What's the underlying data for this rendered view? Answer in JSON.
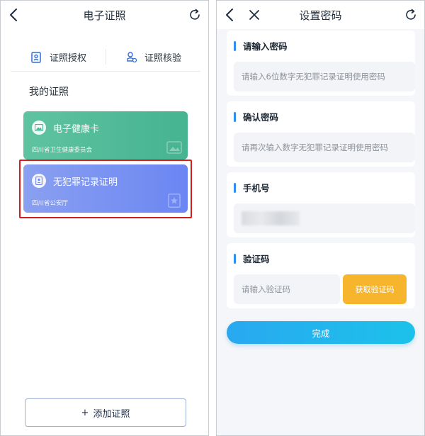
{
  "left": {
    "title": "电子证照",
    "tabs": [
      {
        "label": "证照授权",
        "icon": "badge-icon"
      },
      {
        "label": "证照核验",
        "icon": "stamp-icon"
      }
    ],
    "section_label": "我的证照",
    "cards": [
      {
        "title": "电子健康卡",
        "org": "四川省卫生健康委员会",
        "icon": "image-icon",
        "color": "#4fb998"
      },
      {
        "title": "无犯罪记录证明",
        "org": "四川省公安厅",
        "icon": "id-card-icon",
        "color": "#7890f2"
      }
    ],
    "add_button": {
      "plus": "+",
      "label": "添加证照"
    },
    "highlight_color": "#d21e1e"
  },
  "right": {
    "title": "设置密码",
    "fields": [
      {
        "label": "请输入密码",
        "placeholder": "请输入6位数字无犯罪记录证明使用密码"
      },
      {
        "label": "确认密码",
        "placeholder": "请再次输入数字无犯罪记录证明使用密码"
      },
      {
        "label": "手机号",
        "placeholder": ""
      },
      {
        "label": "验证码",
        "placeholder": "请输入验证码"
      }
    ],
    "get_code_button": "获取验证码",
    "done_button": "完成",
    "accent_color": "#2f8ef0",
    "code_button_color": "#f7b52e"
  }
}
